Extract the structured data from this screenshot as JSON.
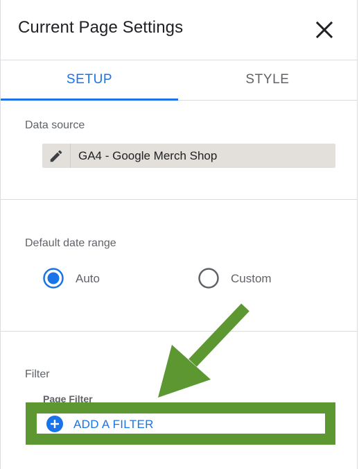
{
  "header": {
    "title": "Current Page Settings",
    "close_icon": "close-icon"
  },
  "tabs": [
    {
      "label": "SETUP",
      "active": true
    },
    {
      "label": "STYLE",
      "active": false
    }
  ],
  "data_source": {
    "label": "Data source",
    "edit_icon": "pencil-icon",
    "value": "GA4 - Google Merch Shop"
  },
  "date_range": {
    "label": "Default date range",
    "options": [
      {
        "label": "Auto",
        "selected": true
      },
      {
        "label": "Custom",
        "selected": false
      }
    ]
  },
  "filter": {
    "label": "Filter",
    "page_filter_label": "Page Filter",
    "add_button_label": "ADD A FILTER",
    "add_icon": "plus-circle-icon"
  },
  "annotation": {
    "arrow_icon": "arrow-icon",
    "highlight_color": "#5d9732"
  },
  "colors": {
    "accent": "#1a73e8",
    "highlight": "#5d9732",
    "source_chip": "#e3e0db"
  }
}
